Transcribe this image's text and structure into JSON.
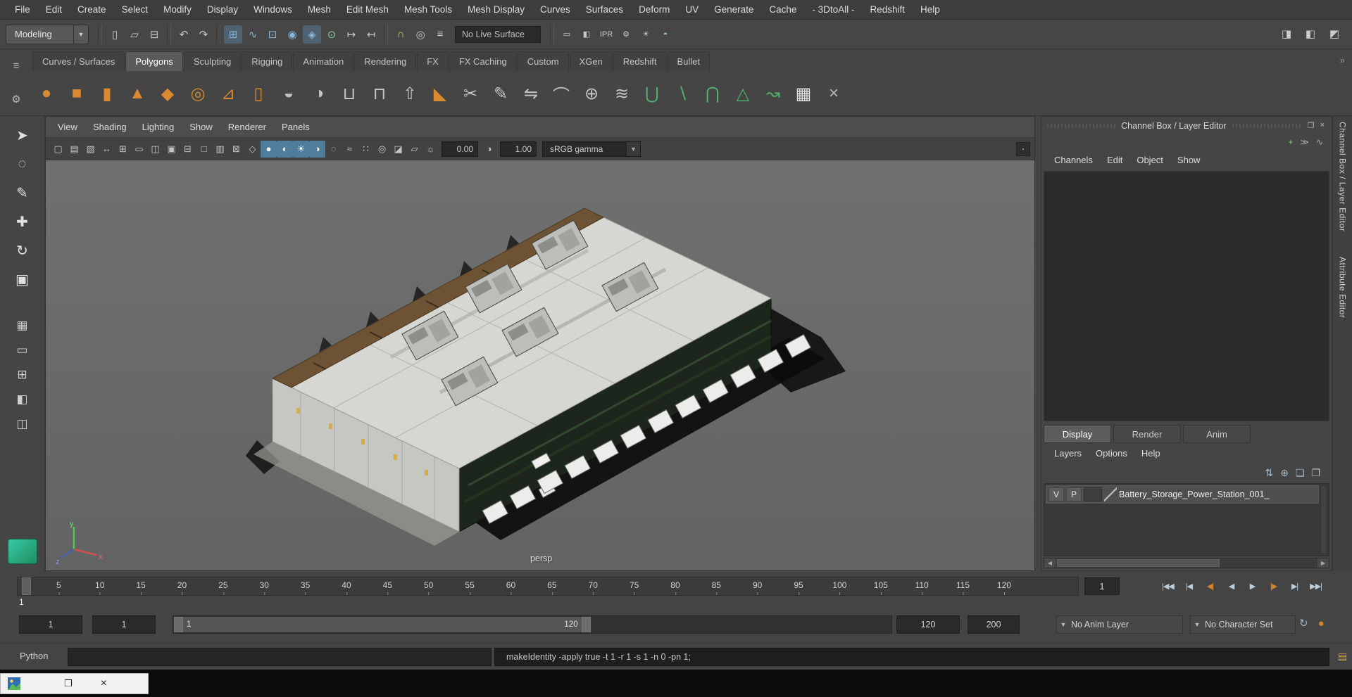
{
  "menubar": {
    "items": [
      {
        "name": "menu-file",
        "label": "File"
      },
      {
        "name": "menu-edit",
        "label": "Edit"
      },
      {
        "name": "menu-create",
        "label": "Create"
      },
      {
        "name": "menu-select",
        "label": "Select"
      },
      {
        "name": "menu-modify",
        "label": "Modify"
      },
      {
        "name": "menu-display",
        "label": "Display"
      },
      {
        "name": "menu-windows",
        "label": "Windows"
      },
      {
        "name": "menu-mesh",
        "label": "Mesh"
      },
      {
        "name": "menu-edit-mesh",
        "label": "Edit Mesh"
      },
      {
        "name": "menu-mesh-tools",
        "label": "Mesh Tools"
      },
      {
        "name": "menu-mesh-display",
        "label": "Mesh Display"
      },
      {
        "name": "menu-curves",
        "label": "Curves"
      },
      {
        "name": "menu-surfaces",
        "label": "Surfaces"
      },
      {
        "name": "menu-deform",
        "label": "Deform"
      },
      {
        "name": "menu-uv",
        "label": "UV"
      },
      {
        "name": "menu-generate",
        "label": "Generate"
      },
      {
        "name": "menu-cache",
        "label": "Cache"
      },
      {
        "name": "menu-3dtoall",
        "label": "- 3DtoAll -"
      },
      {
        "name": "menu-redshift",
        "label": "Redshift"
      },
      {
        "name": "menu-help",
        "label": "Help"
      }
    ]
  },
  "statusline": {
    "menuset_value": "Modeling",
    "live_surface_value": "No Live Surface",
    "file_icons": [
      {
        "name": "new-scene-icon",
        "glyph": "▯"
      },
      {
        "name": "open-scene-icon",
        "glyph": "▱"
      },
      {
        "name": "save-scene-icon",
        "glyph": "⊟"
      }
    ],
    "undo_icons": [
      {
        "name": "undo-icon",
        "glyph": "↶"
      },
      {
        "name": "redo-icon",
        "glyph": "↷"
      }
    ],
    "snap_icons": [
      {
        "name": "snap-to-grids-icon",
        "glyph": "⊞",
        "color": "#86b7da",
        "active": true
      },
      {
        "name": "snap-to-curves-icon",
        "glyph": "∿",
        "color": "#86b7da"
      },
      {
        "name": "snap-to-points-icon",
        "glyph": "⊡",
        "color": "#86b7da"
      },
      {
        "name": "snap-to-projected-center-icon",
        "glyph": "◉",
        "color": "#86b7da"
      },
      {
        "name": "snap-to-view-planes-icon",
        "glyph": "◈",
        "color": "#86b7da",
        "active": true
      },
      {
        "name": "make-live-icon",
        "glyph": "⊙",
        "color": "#8fca9a"
      },
      {
        "name": "input-connections-icon",
        "glyph": "↦"
      },
      {
        "name": "output-connections-icon",
        "glyph": "↤"
      }
    ],
    "history_icons": [
      {
        "name": "lock-selection-icon",
        "glyph": "∩",
        "color": "#d9c96a"
      },
      {
        "name": "highlight-selection-icon",
        "glyph": "◎"
      },
      {
        "name": "construction-history-icon",
        "glyph": "≡"
      }
    ],
    "render_icons": [
      {
        "name": "render-view-icon",
        "glyph": "▭"
      },
      {
        "name": "render-current-frame-icon",
        "glyph": "◧"
      },
      {
        "name": "ipr-render-icon",
        "glyph": "IPR"
      },
      {
        "name": "render-settings-icon",
        "glyph": "⚙"
      },
      {
        "name": "light-editor-icon",
        "glyph": "☀"
      },
      {
        "name": "hypershade-icon",
        "glyph": "◓",
        "color": "#9fc6de"
      }
    ],
    "right_icons": [
      {
        "name": "toggle-attribute-editor-icon",
        "glyph": "◨"
      },
      {
        "name": "toggle-tool-settings-icon",
        "glyph": "◧"
      },
      {
        "name": "toggle-channel-box-icon",
        "glyph": "◩"
      }
    ]
  },
  "shelf": {
    "gutter_icons": [
      {
        "name": "shelf-menu-icon",
        "glyph": "≡"
      },
      {
        "name": "shelf-gear-icon",
        "glyph": "⚙"
      }
    ],
    "overflow_glyph": "»",
    "tabs": [
      {
        "name": "shelf-tab-curves-surfaces",
        "label": "Curves / Surfaces"
      },
      {
        "name": "shelf-tab-polygons",
        "label": "Polygons",
        "active": true
      },
      {
        "name": "shelf-tab-sculpting",
        "label": "Sculpting"
      },
      {
        "name": "shelf-tab-rigging",
        "label": "Rigging"
      },
      {
        "name": "shelf-tab-animation",
        "label": "Animation"
      },
      {
        "name": "shelf-tab-rendering",
        "label": "Rendering"
      },
      {
        "name": "shelf-tab-fx",
        "label": "FX"
      },
      {
        "name": "shelf-tab-fx-caching",
        "label": "FX Caching"
      },
      {
        "name": "shelf-tab-custom",
        "label": "Custom"
      },
      {
        "name": "shelf-tab-xgen",
        "label": "XGen"
      },
      {
        "name": "shelf-tab-redshift",
        "label": "Redshift"
      },
      {
        "name": "shelf-tab-bullet",
        "label": "Bullet"
      }
    ],
    "icons": [
      {
        "name": "poly-sphere-icon",
        "glyph": "●",
        "color": "#d9892f"
      },
      {
        "name": "poly-cube-icon",
        "glyph": "■",
        "color": "#d9892f"
      },
      {
        "name": "poly-cylinder-icon",
        "glyph": "▮",
        "color": "#d9892f"
      },
      {
        "name": "poly-cone-icon",
        "glyph": "▲",
        "color": "#d9892f"
      },
      {
        "name": "poly-plane-icon",
        "glyph": "◆",
        "color": "#d9892f"
      },
      {
        "name": "poly-torus-icon",
        "glyph": "◎",
        "color": "#d9892f"
      },
      {
        "name": "poly-prism-icon",
        "glyph": "⊿",
        "color": "#d9892f"
      },
      {
        "name": "poly-pipe-icon",
        "glyph": "▯",
        "color": "#d9892f"
      },
      {
        "name": "sphere-projection-icon",
        "glyph": "◒",
        "color": "#c4c4c4"
      },
      {
        "name": "smooth-mesh-icon",
        "glyph": "◑",
        "color": "#c4c4c4"
      },
      {
        "name": "combine-icon",
        "glyph": "⊔",
        "color": "#c4c4c4"
      },
      {
        "name": "separate-icon",
        "glyph": "⊓",
        "color": "#c4c4c4"
      },
      {
        "name": "extrude-icon",
        "glyph": "⇧",
        "color": "#c4c4c4"
      },
      {
        "name": "bevel-icon",
        "glyph": "◣",
        "color": "#d9892f"
      },
      {
        "name": "multi-cut-icon",
        "glyph": "✂",
        "color": "#c4c4c4"
      },
      {
        "name": "quad-draw-icon",
        "glyph": "✎",
        "color": "#c4c4c4"
      },
      {
        "name": "mirror-icon",
        "glyph": "⇋",
        "color": "#c4c4c4"
      },
      {
        "name": "bridge-icon",
        "glyph": "⌒",
        "color": "#c4c4c4"
      },
      {
        "name": "target-weld-icon",
        "glyph": "⊕",
        "color": "#c4c4c4"
      },
      {
        "name": "insert-edge-loop-icon",
        "glyph": "≋",
        "color": "#c4c4c4"
      },
      {
        "name": "boolean-union-icon",
        "glyph": "⋃",
        "color": "#54b06c"
      },
      {
        "name": "boolean-difference-icon",
        "glyph": "∖",
        "color": "#54b06c"
      },
      {
        "name": "boolean-intersection-icon",
        "glyph": "⋂",
        "color": "#54b06c"
      },
      {
        "name": "smooth-icon",
        "glyph": "△",
        "color": "#54b06c"
      },
      {
        "name": "sculpt-curve-icon",
        "glyph": "↝",
        "color": "#54b06c"
      },
      {
        "name": "uv-checker-icon",
        "glyph": "▦",
        "color": "#e8e8e8"
      },
      {
        "name": "reduce-mesh-icon",
        "glyph": "×",
        "color": "#b8b8b8"
      }
    ]
  },
  "toolbox": {
    "tools": [
      {
        "name": "select-tool-button",
        "glyph": "➤"
      },
      {
        "name": "lasso-tool-button",
        "glyph": "◌"
      },
      {
        "name": "paint-select-tool-button",
        "glyph": "✎"
      },
      {
        "name": "move-tool-button",
        "glyph": "✚"
      },
      {
        "name": "rotate-tool-button",
        "glyph": "↻"
      },
      {
        "name": "scale-tool-button",
        "glyph": "▣"
      }
    ],
    "layouts": [
      {
        "name": "checker-swatch-icon",
        "glyph": "▦"
      },
      {
        "name": "single-pane-layout-button",
        "glyph": "▭"
      },
      {
        "name": "four-pane-layout-button",
        "glyph": "⊞"
      },
      {
        "name": "persp-outliner-layout-button",
        "glyph": "◧"
      },
      {
        "name": "two-pane-layout-button",
        "glyph": "◫"
      }
    ]
  },
  "panel": {
    "menus": [
      {
        "name": "panel-menu-view",
        "label": "View"
      },
      {
        "name": "panel-menu-shading",
        "label": "Shading"
      },
      {
        "name": "panel-menu-lighting",
        "label": "Lighting"
      },
      {
        "name": "panel-menu-show",
        "label": "Show"
      },
      {
        "name": "panel-menu-renderer",
        "label": "Renderer"
      },
      {
        "name": "panel-menu-panels",
        "label": "Panels"
      }
    ],
    "toolbar_icons": [
      {
        "name": "camera-attributes-icon",
        "glyph": "▢"
      },
      {
        "name": "bookmarks-icon",
        "glyph": "▤"
      },
      {
        "name": "image-plane-icon",
        "glyph": "▧"
      },
      {
        "name": "2d-pan-zoom-icon",
        "glyph": "↔"
      },
      {
        "name": "grid-icon",
        "glyph": "⊞"
      },
      {
        "name": "film-gate-icon",
        "glyph": "▭"
      },
      {
        "name": "resolution-gate-icon",
        "glyph": "◫"
      },
      {
        "name": "gate-mask-icon",
        "glyph": "▣"
      },
      {
        "name": "field-chart-icon",
        "glyph": "⊟"
      },
      {
        "name": "safe-action-icon",
        "glyph": "□"
      },
      {
        "name": "safe-title-icon",
        "glyph": "▥"
      },
      {
        "name": "frame-all-icon",
        "glyph": "⊠"
      },
      {
        "name": "wireframe-icon",
        "glyph": "◇"
      },
      {
        "name": "smooth-shade-icon",
        "glyph": "●",
        "active": true
      },
      {
        "name": "textured-icon",
        "glyph": "◐",
        "active": true
      },
      {
        "name": "lights-icon",
        "glyph": "☀",
        "active": true
      },
      {
        "name": "shadows-icon",
        "glyph": "◑",
        "active": true
      },
      {
        "name": "screen-space-ao-icon",
        "glyph": "◌"
      },
      {
        "name": "motion-blur-icon",
        "glyph": "≈"
      },
      {
        "name": "multisample-icon",
        "glyph": "∷"
      },
      {
        "name": "depth-of-field-icon",
        "glyph": "◎"
      },
      {
        "name": "isolate-select-icon",
        "glyph": "◪"
      },
      {
        "name": "xray-icon",
        "glyph": "▱"
      },
      {
        "name": "exposure-icon",
        "glyph": "☼"
      }
    ],
    "exposure_value": "0.00",
    "contrast_icon_glyph": "◑",
    "gamma_value": "1.00",
    "view_transform_value": "sRGB gamma",
    "camera_label": "persp",
    "axis": {
      "x": "x",
      "y": "y",
      "z": "z"
    }
  },
  "channel_box": {
    "title": "Channel Box / Layer Editor",
    "title_icons": [
      {
        "name": "undock-panel-icon",
        "glyph": "❐"
      },
      {
        "name": "close-panel-icon",
        "glyph": "×"
      }
    ],
    "quick_icons": [
      {
        "name": "channel-manipulator-icon",
        "glyph": "+",
        "color": "#8fca7a"
      },
      {
        "name": "channel-speed-icon",
        "glyph": "≫",
        "color": "#b0b0b0"
      },
      {
        "name": "channel-hyperbolic-icon",
        "glyph": "∿",
        "color": "#b0b0b0"
      }
    ],
    "menus": [
      {
        "name": "channels-menu",
        "label": "Channels"
      },
      {
        "name": "cb-edit-menu",
        "label": "Edit"
      },
      {
        "name": "cb-object-menu",
        "label": "Object"
      },
      {
        "name": "cb-show-menu",
        "label": "Show"
      }
    ]
  },
  "layer_editor": {
    "tabs": [
      {
        "name": "layer-tab-display",
        "label": "Display",
        "active": true
      },
      {
        "name": "layer-tab-render",
        "label": "Render"
      },
      {
        "name": "layer-tab-anim",
        "label": "Anim"
      }
    ],
    "menus": [
      {
        "name": "layers-menu",
        "label": "Layers"
      },
      {
        "name": "layer-options-menu",
        "label": "Options"
      },
      {
        "name": "layer-help-menu",
        "label": "Help"
      }
    ],
    "action_icons": [
      {
        "name": "sync-layers-icon",
        "glyph": "⇅"
      },
      {
        "name": "add-selected-to-layer-icon",
        "glyph": "⊕"
      },
      {
        "name": "create-empty-layer-icon",
        "glyph": "❏"
      },
      {
        "name": "create-layer-from-selected-icon",
        "glyph": "❐"
      }
    ],
    "layer_row": {
      "visibility": "V",
      "playback": "P",
      "layer_name": "Battery_Storage_Power_Station_001_"
    }
  },
  "right_tabs": [
    {
      "name": "tab-channel-box-layer-editor",
      "label": "Channel Box / Layer Editor"
    },
    {
      "name": "tab-attribute-editor",
      "label": "Attribute Editor"
    }
  ],
  "timeline": {
    "labels": [
      "5",
      "10",
      "15",
      "20",
      "25",
      "30",
      "35",
      "40",
      "45",
      "50",
      "55",
      "60",
      "65",
      "70",
      "75",
      "80",
      "85",
      "90",
      "95",
      "100",
      "105",
      "110",
      "115",
      "120"
    ],
    "playhead_label": "1",
    "current_frame_value": "1",
    "playback": [
      {
        "name": "go-to-start-button",
        "glyph": "|◀◀"
      },
      {
        "name": "step-back-frame-button",
        "glyph": "|◀"
      },
      {
        "name": "step-back-key-button",
        "glyph": "◀|",
        "color": "#d2822f"
      },
      {
        "name": "play-backwards-button",
        "glyph": "◀"
      },
      {
        "name": "play-forwards-button",
        "glyph": "▶"
      },
      {
        "name": "step-forward-key-button",
        "glyph": "|▶",
        "color": "#d2822f"
      },
      {
        "name": "step-forward-frame-button",
        "glyph": "▶|"
      },
      {
        "name": "go-to-end-button",
        "glyph": "▶▶|"
      }
    ]
  },
  "range_bar": {
    "fields": {
      "anim_start": "1",
      "playback_start": "1",
      "playback_end": "120",
      "anim_end": "200"
    },
    "inner_start": "1",
    "inner_end": "120",
    "anim_layer": "No Anim Layer",
    "character_set": "No Character Set",
    "icons": [
      {
        "name": "anim-preferences-icon",
        "glyph": "↻",
        "color": "#9fb6c9"
      },
      {
        "name": "auto-keyframe-icon",
        "glyph": "●",
        "color": "#d2822f"
      }
    ]
  },
  "command_line": {
    "label": "Python",
    "input_value": "",
    "result": "makeIdentity -apply true -t 1 -r 1 -s 1 -n 0 -pn 1;",
    "icon_glyph": "▤"
  },
  "taskbar": {
    "restore_glyph": "❐",
    "close_glyph": "×"
  }
}
